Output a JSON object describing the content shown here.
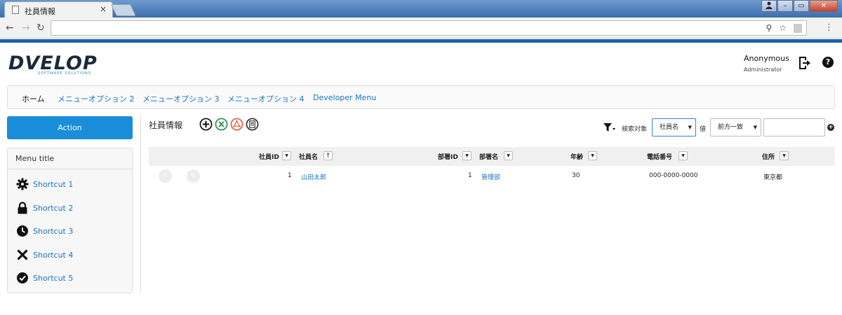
{
  "browser": {
    "tab_title": "社員情報",
    "tab_close": "×",
    "back": "←",
    "forward": "→",
    "reload": "↻",
    "omnibox_value": "",
    "zoom_icon": "⚲",
    "star_icon": "☆",
    "menu_dots": "⋮",
    "win_min": "–",
    "win_max": "▭",
    "win_close": "✕"
  },
  "header": {
    "logo_text": "DVELOP",
    "logo_sub": "SOFTWARE SOLUTIONS",
    "user_name": "Anonymous",
    "user_role": "Administrator",
    "help": "?"
  },
  "nav": {
    "items": [
      {
        "label": "ホーム"
      },
      {
        "label": "メニューオプション 2"
      },
      {
        "label": "メニューオプション 3"
      },
      {
        "label": "メニューオプション 4"
      },
      {
        "label": "Developer Menu"
      }
    ]
  },
  "sidebar": {
    "action_label": "Action",
    "menu_title": "Menu title",
    "shortcuts": [
      {
        "label": "Shortcut 1",
        "icon": "gear-icon"
      },
      {
        "label": "Shortcut 2",
        "icon": "lock-icon"
      },
      {
        "label": "Shortcut 3",
        "icon": "clock-icon"
      },
      {
        "label": "Shortcut 4",
        "icon": "x-icon"
      },
      {
        "label": "Shortcut 5",
        "icon": "check-circle-icon"
      }
    ]
  },
  "content": {
    "title": "社員情報",
    "search_target_label": "検索対象",
    "search_target_value": "社員名",
    "value_label": "値",
    "match_mode": "前方一致",
    "search_value": "",
    "add_condition": "+"
  },
  "table": {
    "columns": [
      "社員ID",
      "社員名",
      "部署ID",
      "部署名",
      "年齢",
      "電話番号",
      "住所"
    ],
    "sort_down": "▼",
    "sort_up": "↑",
    "rows": [
      {
        "emp_id": "1",
        "emp_name": "山田太郎",
        "dept_id": "1",
        "dept_name": "管理部",
        "age": "30",
        "phone": "000-0000-0000",
        "address": "東京都"
      }
    ]
  },
  "colors": {
    "accent": "#1a8ed8",
    "link": "#1a73c4",
    "browser_blue": "#1e5fa8"
  }
}
